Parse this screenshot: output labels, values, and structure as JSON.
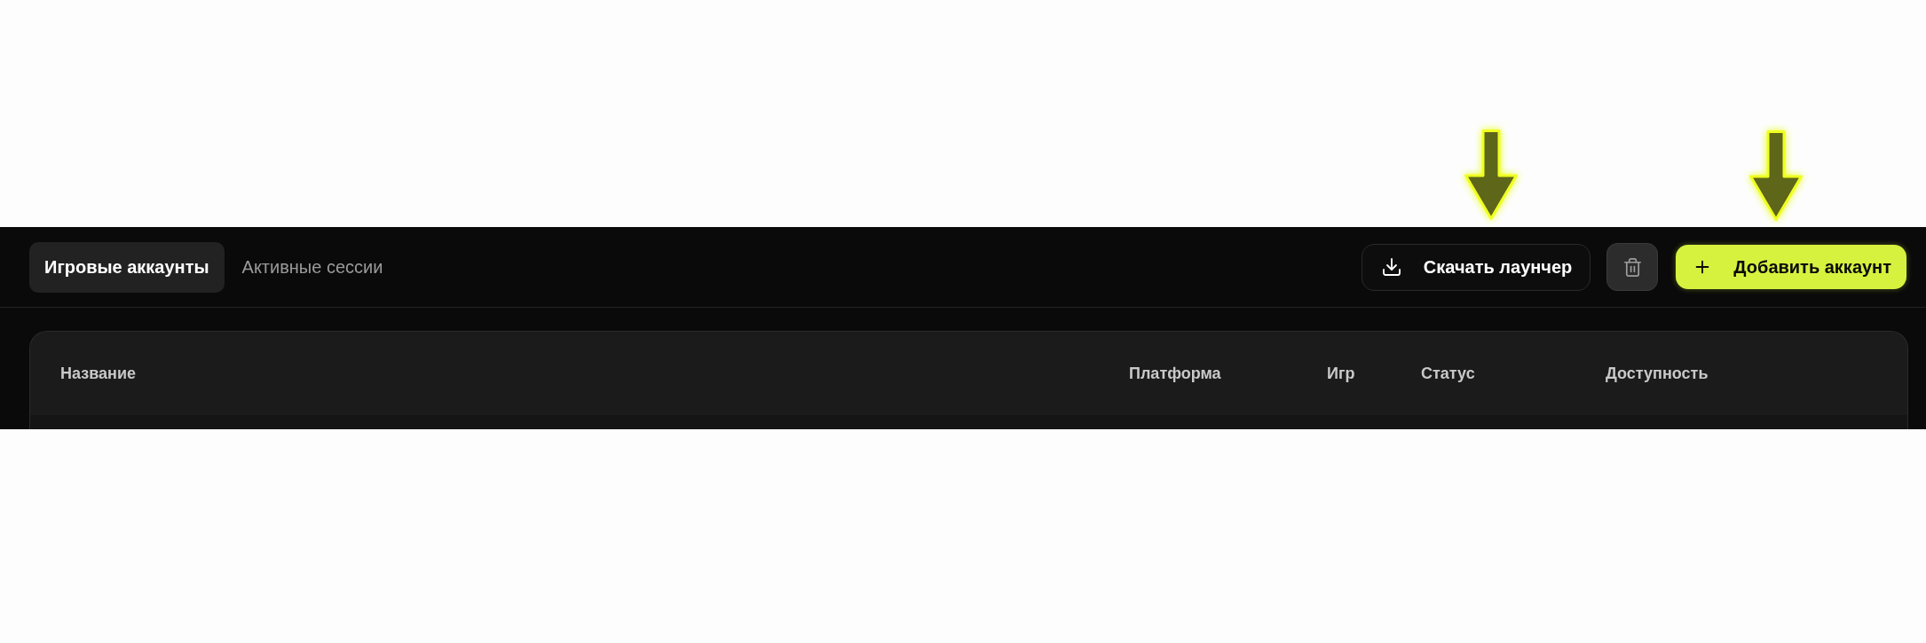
{
  "tabs": [
    {
      "label": "Игровые аккаунты",
      "selected": true
    },
    {
      "label": "Активные сессии",
      "selected": false
    }
  ],
  "download_button": {
    "label": "Скачать лаунчер",
    "highlighted": true
  },
  "delete_button": {
    "highlighted": false
  },
  "add_button": {
    "label": "Добавить аккаунт",
    "highlighted": true
  },
  "table": {
    "columns": [
      "Название",
      "Платформа",
      "Игр",
      "Статус",
      "Доступность"
    ]
  }
}
